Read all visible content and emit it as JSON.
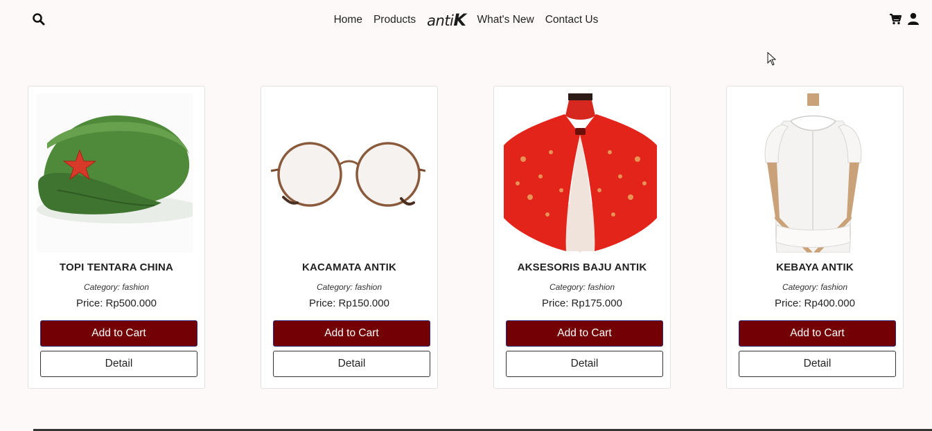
{
  "nav": {
    "links_left": [
      "Home",
      "Products"
    ],
    "brand_prefix": "anti",
    "brand_suffix": "K",
    "links_right": [
      "What's New",
      "Contact Us"
    ]
  },
  "products": [
    {
      "name": "TOPI TENTARA CHINA",
      "category": "Category: fashion",
      "price": "Price: Rp500.000",
      "add_label": "Add to Cart",
      "detail_label": "Detail"
    },
    {
      "name": "KACAMATA ANTIK",
      "category": "Category: fashion",
      "price": "Price: Rp150.000",
      "add_label": "Add to Cart",
      "detail_label": "Detail"
    },
    {
      "name": "AKSESORIS BAJU ANTIK",
      "category": "Category: fashion",
      "price": "Price: Rp175.000",
      "add_label": "Add to Cart",
      "detail_label": "Detail"
    },
    {
      "name": "KEBAYA ANTIK",
      "category": "Category: fashion",
      "price": "Price: Rp400.000",
      "add_label": "Add to Cart",
      "detail_label": "Detail"
    }
  ],
  "colors": {
    "background": "#fdf9f8",
    "cart_button": "#720005",
    "cart_button_border": "#2c2a7a"
  },
  "icons": [
    "search-icon",
    "cart-icon",
    "user-icon",
    "mouse-cursor"
  ]
}
